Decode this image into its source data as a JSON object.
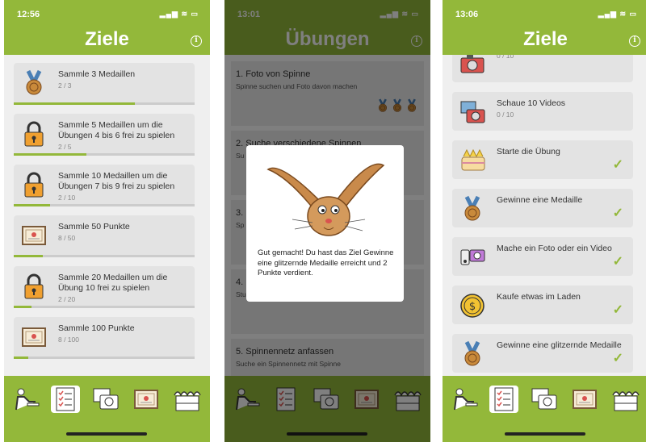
{
  "screen1": {
    "time": "12:56",
    "status_icons": "▂▄▆ ≋ ▭",
    "title": "Ziele",
    "goals": [
      {
        "icon": "medal-icon",
        "label": "Sammle 3 Medaillen",
        "progress": "2 / 3",
        "fraction": 0.67
      },
      {
        "icon": "lock-icon",
        "label": "Sammle 5 Medaillen um die Übungen 4 bis 6 frei zu spielen",
        "progress": "2 / 5",
        "fraction": 0.4
      },
      {
        "icon": "lock-icon",
        "label": "Sammle 10 Medaillen um die Übungen 7 bis 9 frei zu spielen",
        "progress": "2 / 10",
        "fraction": 0.2
      },
      {
        "icon": "certificate-icon",
        "label": "Sammle 50 Punkte",
        "progress": "8 / 50",
        "fraction": 0.16
      },
      {
        "icon": "lock-icon",
        "label": "Sammle 20 Medaillen um die Übung 10 frei zu spielen",
        "progress": "2 / 20",
        "fraction": 0.1
      },
      {
        "icon": "certificate-icon",
        "label": "Sammle 100 Punkte",
        "progress": "8 / 100",
        "fraction": 0.08
      }
    ]
  },
  "screen2": {
    "time": "13:01",
    "status_icons": "▂▄▆ ≋ ▭",
    "title": "Übungen",
    "exercises": [
      {
        "name": "1. Foto von Spinne",
        "desc": "Spinne suchen und Foto davon machen"
      },
      {
        "name": "2. Suche verschiedene Spinnen",
        "desc": "Su"
      },
      {
        "name": "3.",
        "desc": "Sp"
      },
      {
        "name": "4.",
        "desc": "Stu"
      },
      {
        "name": "5. Spinnennetz anfassen",
        "desc": "Suche ein Spinnennetz mit Spinne"
      }
    ],
    "dialog_message": "Gut gemacht! Du hast das Ziel Gewinne eine glitzernde Medaille erreicht und  2 Punkte verdient."
  },
  "screen3": {
    "time": "13:06",
    "status_icons": "▂▄▆ ≋ ▭",
    "title": "Ziele",
    "goals": [
      {
        "icon": "camera-icon",
        "label": "",
        "progress": "0 / 10",
        "done": false
      },
      {
        "icon": "video-camera-icon",
        "label": "Schaue 10 Videos",
        "progress": "0 / 10",
        "done": false
      },
      {
        "icon": "cake-icon",
        "label": "Starte die Übung",
        "progress": "",
        "done": true
      },
      {
        "icon": "medal-icon",
        "label": "Gewinne eine Medaille",
        "progress": "",
        "done": true
      },
      {
        "icon": "phone-camera-icon",
        "label": "Mache ein Foto oder ein Video",
        "progress": "",
        "done": true
      },
      {
        "icon": "coin-icon",
        "label": "Kaufe etwas im Laden",
        "progress": "",
        "done": true
      },
      {
        "icon": "medal-icon",
        "label": "Gewinne eine glitzernde Medaille",
        "progress": "",
        "done": true
      }
    ]
  },
  "check_mark": "✓",
  "info_glyph": "i",
  "tabs": [
    "person-at-desk-icon",
    "checklist-icon",
    "photos-icon",
    "certificate-icon",
    "market-stall-icon"
  ],
  "colors": {
    "brand_green": "#93b83a",
    "card_bg": "#e3e3e3"
  }
}
